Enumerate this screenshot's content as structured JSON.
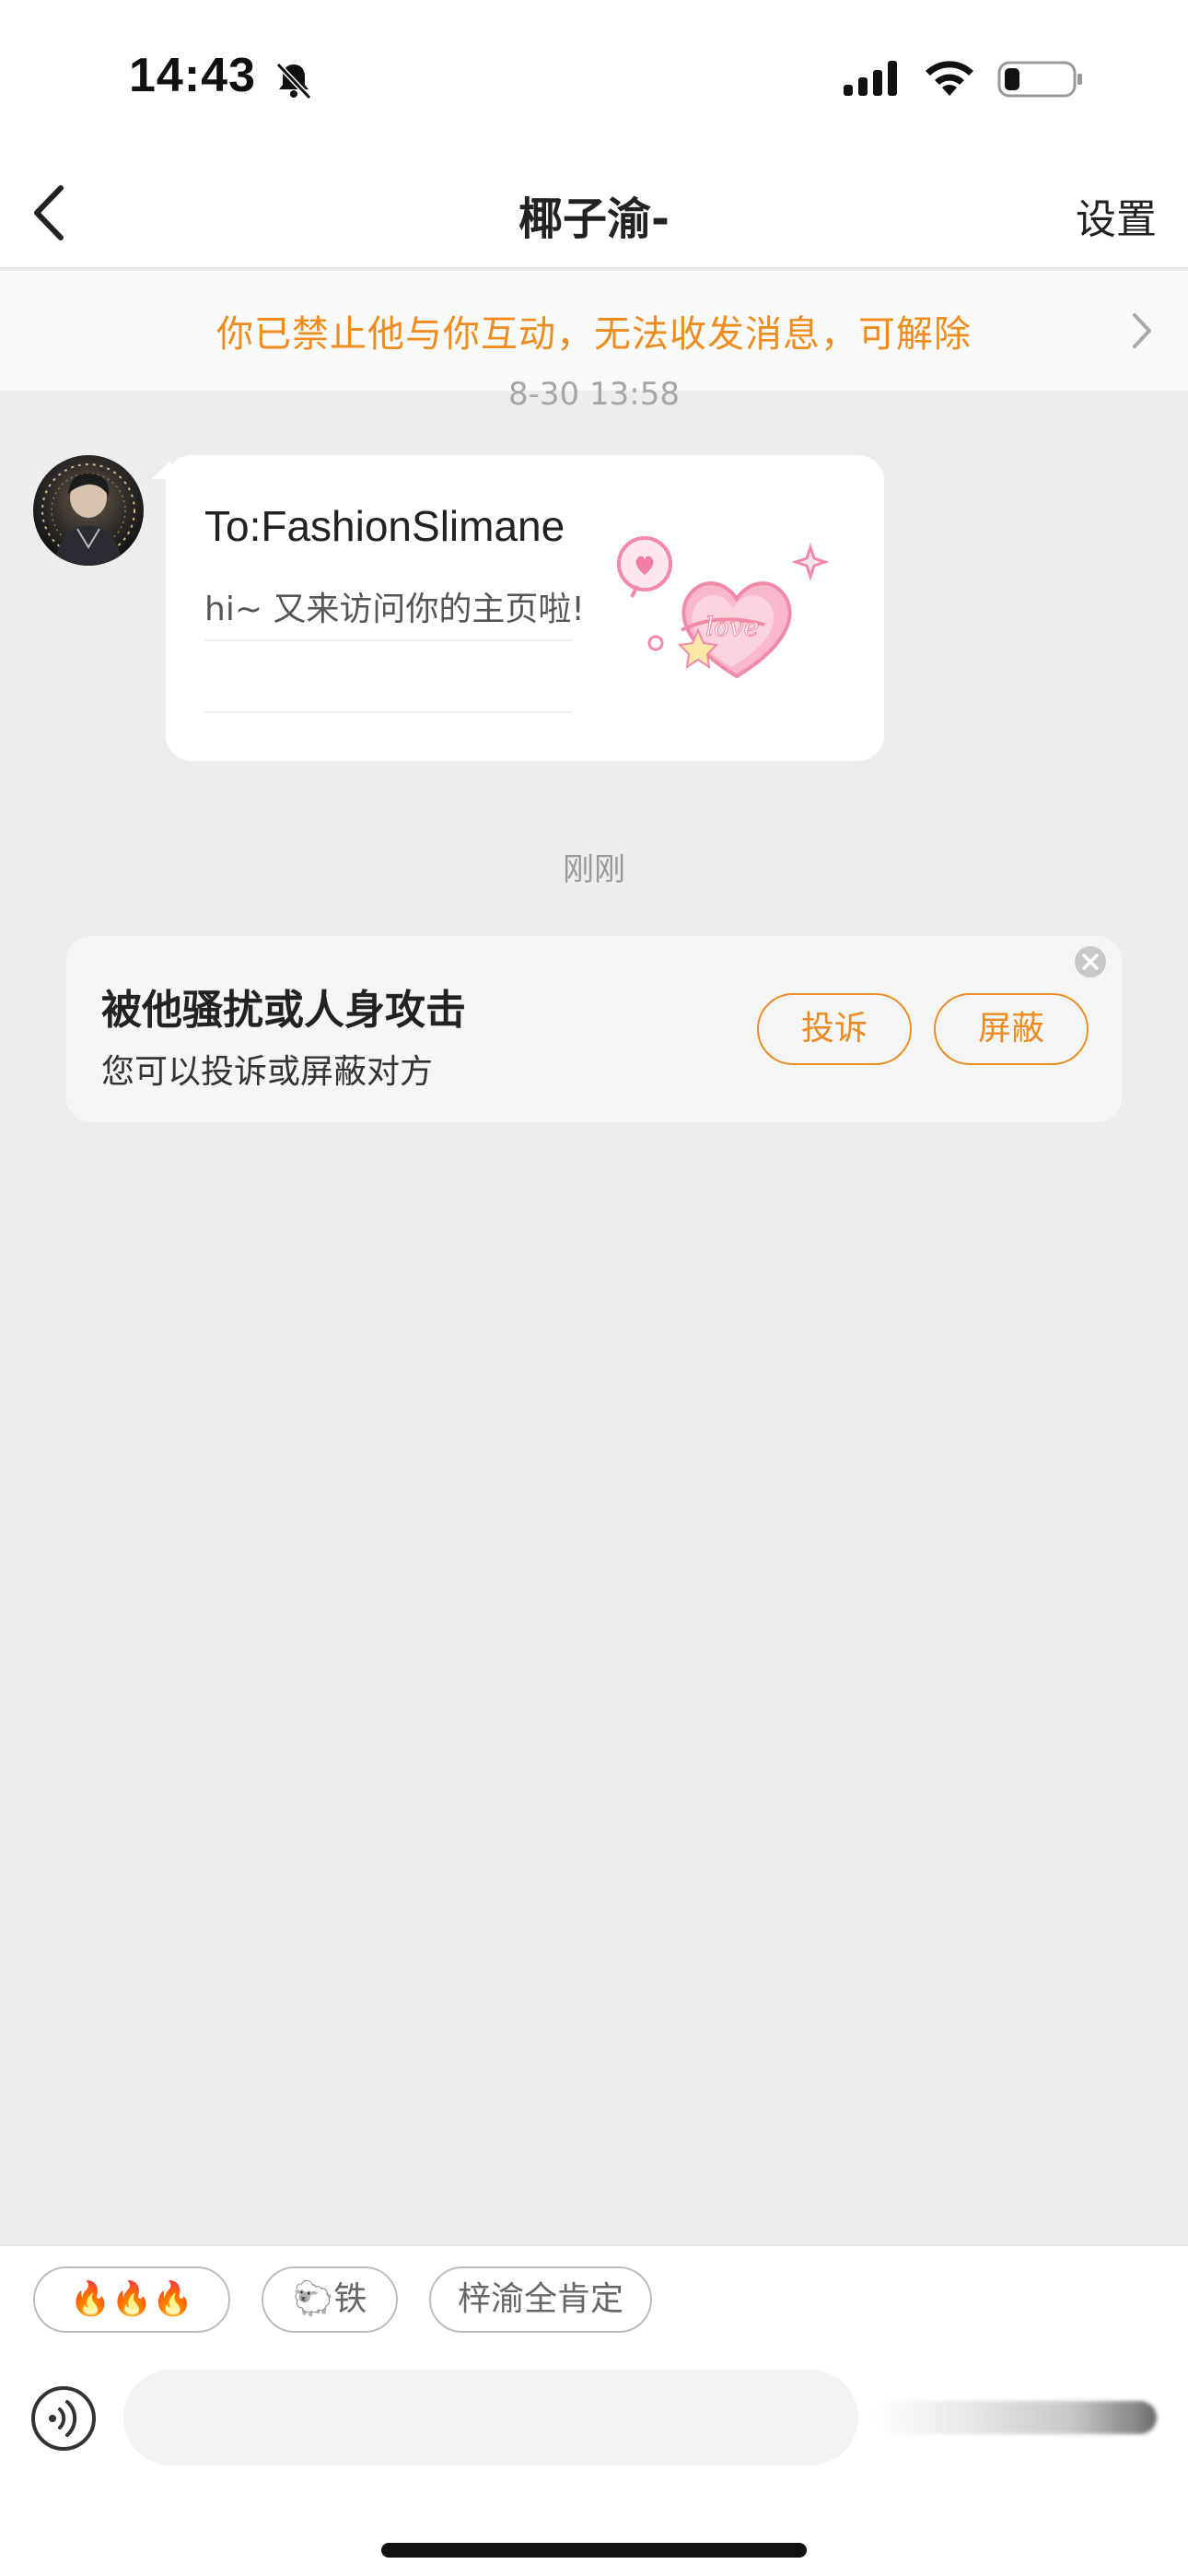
{
  "status_bar": {
    "time": "14:43",
    "icons": [
      "bell-slash-icon",
      "signal-icon",
      "wifi-icon",
      "battery-icon"
    ]
  },
  "nav": {
    "back_icon": "chevron-left-icon",
    "title": "椰子渝-",
    "settings_label": "设置"
  },
  "banner": {
    "text": "你已禁止他与你互动，无法收发消息，可解除",
    "icon": "chevron-right-icon",
    "color": "#f08c1e"
  },
  "chat": {
    "timestamp_top": "8-30 13:58",
    "message_card": {
      "title": "To:FashionSlimane",
      "subtitle": "hi~ 又来访问你的主页啦!",
      "sticker": "love-heart-sticker"
    },
    "timestamp_mid": "刚刚",
    "harassment_card": {
      "title": "被他骚扰或人身攻击",
      "description": "您可以投诉或屏蔽对方",
      "report_label": "投诉",
      "block_label": "屏蔽",
      "accent_color": "#ee8a20"
    }
  },
  "input_bar": {
    "quick_replies": [
      "🔥🔥🔥",
      "🐑铁",
      "梓渝全肯定"
    ],
    "voice_icon": "voice-icon",
    "input_placeholder": ""
  }
}
